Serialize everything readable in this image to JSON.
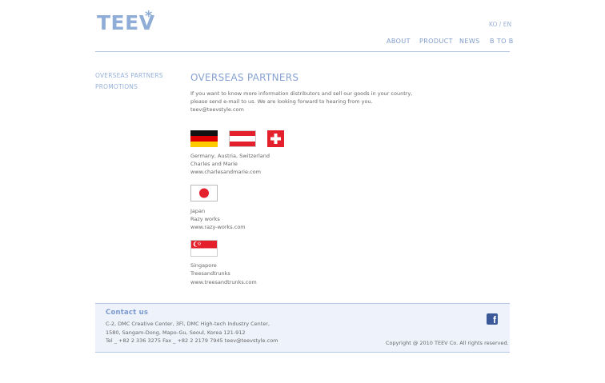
{
  "header": {
    "logo_text": "TEEV",
    "logo_mark": "*",
    "language_switch": "KO / EN",
    "nav": [
      "ABOUT",
      "PRODUCT",
      "NEWS",
      "B TO B"
    ]
  },
  "sidebar": {
    "items": [
      "OVERSEAS PARTNERS",
      "PROMOTIONS"
    ]
  },
  "main": {
    "title": "OVERSEAS PARTNERS",
    "intro_lines": [
      "If you want to know more information distributors and sell our goods in your country,",
      "please send e-mail to us. We are looking forward to hearing from you.",
      "teev@teevstyle.com"
    ],
    "partners": [
      {
        "flags": [
          "germany-flag",
          "austria-flag",
          "switzerland-flag"
        ],
        "country": "Germany, Austria, Switzerland",
        "name": "Charles and Marie",
        "url": "www.charlesandmarie.com"
      },
      {
        "flags": [
          "japan-flag"
        ],
        "country": "Japan",
        "name": "Razy works",
        "url": "www.razy-works.com"
      },
      {
        "flags": [
          "singapore-flag"
        ],
        "country": "Singapore",
        "name": "Treesandtrunks",
        "url": "www.treesandtrunks.com"
      }
    ]
  },
  "footer": {
    "contact_title": "Contact us",
    "address_lines": [
      "C-2, DMC Creative Center, 3Fl, DMC High-tech Industry Center,",
      "1580, Sangam-Dong, Mapo-Gu, Seoul, Korea 121-912",
      "Tel _ +82 2 336 3275   Fax _ +82 2 2179 7945   teev@teevstyle.com"
    ],
    "copyright": "Copyright @ 2010 TEEV Co. All rights reserved.",
    "facebook_icon": "facebook-icon"
  },
  "colors": {
    "accent": "#8fadd6",
    "footer_bg": "#eef2fb"
  }
}
